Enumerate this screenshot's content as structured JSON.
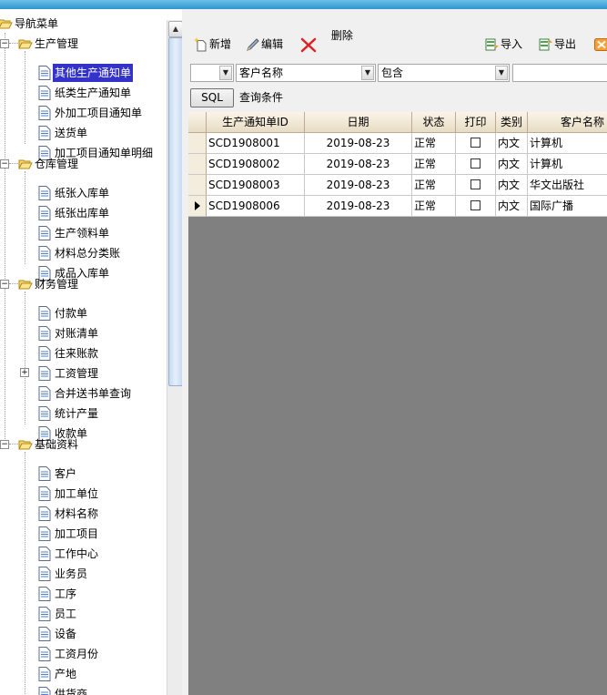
{
  "tree": {
    "root": "导航菜单",
    "groups": [
      {
        "label": "生产管理",
        "items": [
          "其他生产通知单",
          "纸类生产通知单",
          "外加工项目通知单",
          "送货单",
          "加工项目通知单明细"
        ]
      },
      {
        "label": "仓库管理",
        "items": [
          "纸张入库单",
          "纸张出库单",
          "生产领料单",
          "材料总分类账",
          "成品入库单"
        ]
      },
      {
        "label": "财务管理",
        "items": [
          "付款单",
          "对账清单",
          "往来账款",
          "工资管理",
          "合并送书单查询",
          "统计产量",
          "收款单"
        ]
      },
      {
        "label": "基础资料",
        "items": [
          "客户",
          "加工单位",
          "材料名称",
          "加工项目",
          "工作中心",
          "业务员",
          "工序",
          "员工",
          "设备",
          "工资月份",
          "产地",
          "供货商"
        ]
      }
    ],
    "selected": "其他生产通知单"
  },
  "toolbar": {
    "new": "新增",
    "edit": "编辑",
    "delete": "删除",
    "import": "导入",
    "export": "导出"
  },
  "filter": {
    "field": "客户名称",
    "operator": "包含",
    "value": ""
  },
  "sql_button": "SQL",
  "query_label": "查询条件",
  "grid": {
    "columns": [
      "生产通知单ID",
      "日期",
      "状态",
      "打印",
      "类别",
      "客户名称"
    ],
    "rows": [
      {
        "id": "SCD1908001",
        "date": "2019-08-23",
        "status": "正常",
        "printed": false,
        "category": "内文",
        "customer": "计算机"
      },
      {
        "id": "SCD1908002",
        "date": "2019-08-23",
        "status": "正常",
        "printed": false,
        "category": "内文",
        "customer": "计算机"
      },
      {
        "id": "SCD1908003",
        "date": "2019-08-23",
        "status": "正常",
        "printed": false,
        "category": "内文",
        "customer": "华文出版社"
      },
      {
        "id": "SCD1908006",
        "date": "2019-08-23",
        "status": "正常",
        "printed": false,
        "category": "内文",
        "customer": "国际广播"
      }
    ],
    "current_row": 3
  },
  "colors": {
    "selection": "#3333cc",
    "grid_background": "#808080",
    "header": "#f1e8d5"
  }
}
